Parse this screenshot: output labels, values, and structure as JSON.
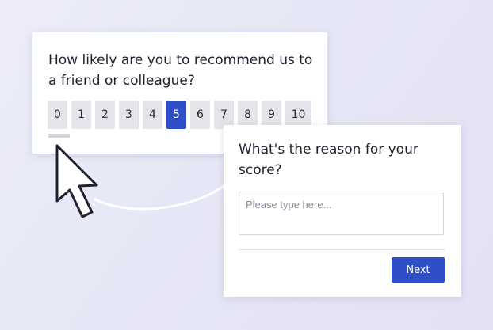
{
  "nps_card": {
    "question": "How likely are you to recommend us to a friend or colleague?",
    "scale": [
      "0",
      "1",
      "2",
      "3",
      "4",
      "5",
      "6",
      "7",
      "8",
      "9",
      "10"
    ],
    "selected": "5"
  },
  "reason_card": {
    "title": "What's the reason for your score?",
    "input_placeholder": "Please type here...",
    "input_value": "",
    "next_label": "Next"
  },
  "colors": {
    "accent": "#2e4fc8",
    "unselected": "#e4e5ea",
    "text": "#1f2030"
  },
  "icons": {
    "pointer": "mouse-pointer-icon",
    "connector": "curved-connector-line"
  }
}
